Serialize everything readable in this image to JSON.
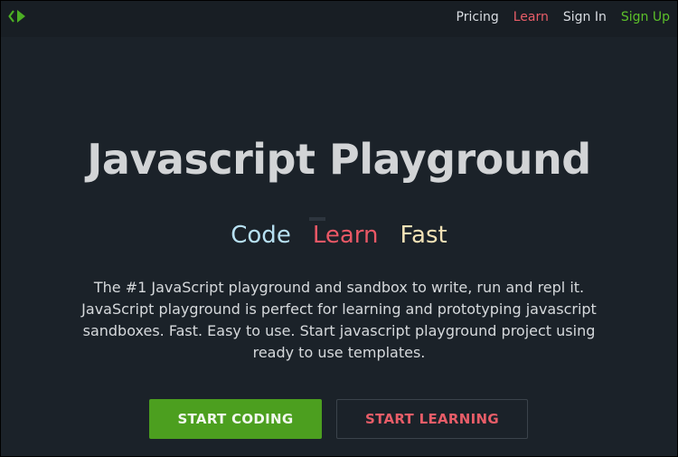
{
  "navbar": {
    "logo_icon": "code-play-icon",
    "links": [
      {
        "label": "Pricing"
      },
      {
        "label": "Learn",
        "color": "#e85d68"
      },
      {
        "label": "Sign In"
      },
      {
        "label": "Sign Up",
        "color": "#5cc02a"
      }
    ]
  },
  "hero": {
    "title": "Javascript Playground",
    "tagline": [
      "Code",
      "Learn",
      "Fast"
    ],
    "description": "The #1 JavaScript playground and sandbox to write, run and repl it. JavaScript playground is perfect for learning and prototyping javascript sandboxes. Fast. Easy to use. Start javascript playground project using ready to use templates."
  },
  "buttons": {
    "start_coding": "START CODING",
    "start_learning": "START LEARNING"
  },
  "colors": {
    "background": "#1b2229",
    "navbar": "#181e24",
    "accent_green": "#4c9f1f",
    "accent_red": "#e85d68"
  }
}
